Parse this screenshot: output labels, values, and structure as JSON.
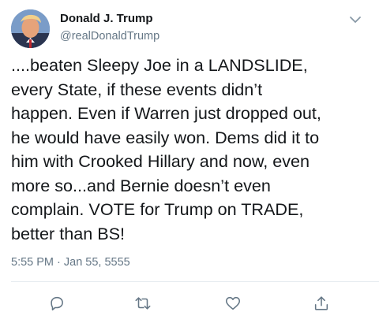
{
  "user": {
    "display_name": "Donald J. Trump",
    "handle": "@realDonaldTrump",
    "avatar_icon": "profile-photo"
  },
  "tweet": {
    "text": "....beaten Sleepy Joe in a LANDSLIDE,\nevery State, if these events didn’t\nhappen. Even if Warren just dropped out,\nhe would have easily won. Dems did it to\nhim with Crooked Hillary and now, even\nmore so...and Bernie doesn’t even\ncomplain. VOTE for Trump on TRADE,\nbetter than BS!",
    "timestamp": "5:55 PM · Jan 55, 5555"
  },
  "actions": [
    {
      "icon": "reply-icon"
    },
    {
      "icon": "retweet-icon"
    },
    {
      "icon": "like-icon"
    },
    {
      "icon": "share-icon"
    }
  ],
  "colors": {
    "text": "#14171a",
    "secondary": "#657786",
    "divider": "#e6ecf0",
    "icon": "#657786"
  }
}
